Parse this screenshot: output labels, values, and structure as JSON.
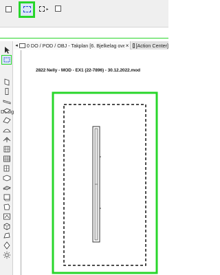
{
  "toolbar": {
    "icons": [
      "marquee-rectangle-icon",
      "marquee-polygon-selected-icon",
      "marquee-dropdown-icon",
      "marquee-option-icon"
    ]
  },
  "toolbox": {
    "section_label": "Design",
    "tools": [
      "arrow-icon",
      "marquee-icon",
      "wall-icon",
      "column-icon",
      "beam-icon",
      "slab-icon",
      "roof-icon",
      "shell-icon",
      "mesh-icon",
      "curtain-wall-icon",
      "railing-icon",
      "stair-icon",
      "window-icon",
      "door-icon",
      "skylight-icon",
      "zone-icon",
      "object-icon",
      "lamp-icon",
      "morph-icon",
      "opening-icon",
      "sun-icon"
    ]
  },
  "tabs": {
    "active_label": "0 DO / POD / OBJ - Takplan [6. Bjelkelag over",
    "close_glyph": "×",
    "second_label": "[Action Center]"
  },
  "drawing": {
    "title": "2822 Nelly - MOD - EX1 (22-7896) - 30.12.2022.mod"
  },
  "colors": {
    "highlight": "#27d62a",
    "selection_blue": "#1f3fd1"
  }
}
